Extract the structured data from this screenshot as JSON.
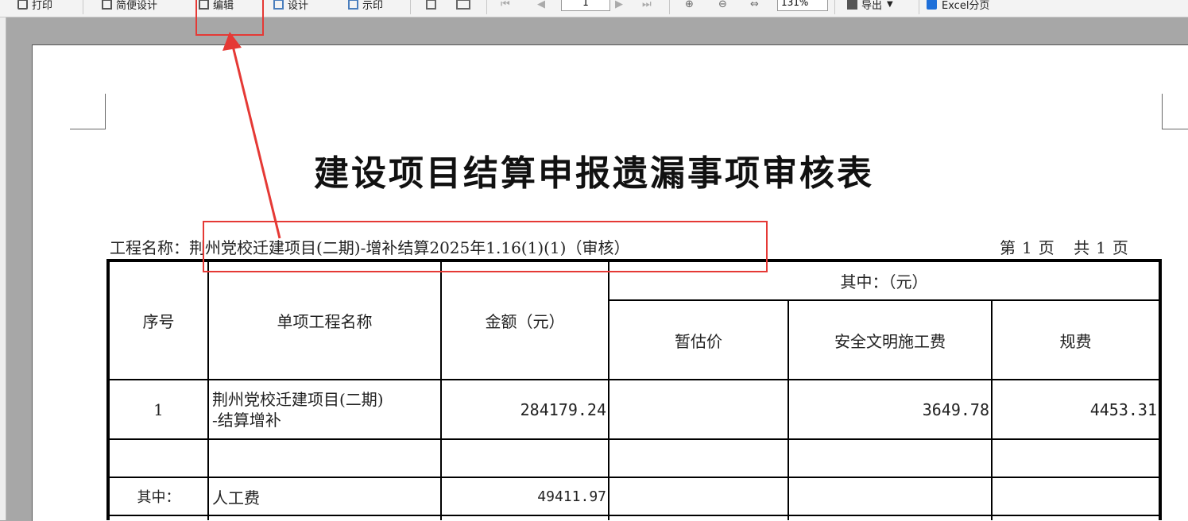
{
  "toolbar": {
    "print_label": "打印",
    "simple_design_label": "简便设计",
    "edit_label": "编辑",
    "design_label": "设计",
    "show_label": "示印",
    "page_value": "1",
    "zoom_value": "131%",
    "export_label": "导出",
    "excel_label": "Excel分页"
  },
  "report": {
    "title": "建设项目结算申报遗漏事项审核表",
    "project_label": "工程名称：",
    "project_name": "荆州党校迁建项目(二期)-增补结算2025年1.16(1)(1)（审核）",
    "page_prefix": "第",
    "page_current": "1",
    "page_mid": "页",
    "page_total_prefix": "共",
    "page_total": "1",
    "page_suffix": "页"
  },
  "table": {
    "headers": {
      "seq": "序号",
      "name": "单项工程名称",
      "amount": "金额（元）",
      "group": "其中：（元）",
      "provisional": "暂估价",
      "safety": "安全文明施工费",
      "fees": "规费"
    },
    "rows": [
      {
        "seq": "1",
        "name_line1": "荆州党校迁建项目(二期)",
        "name_line2": "-结算增补",
        "amount": "284179.24",
        "provisional": "",
        "safety": "3649.78",
        "fees": "4453.31"
      },
      {
        "seq": "",
        "name": "",
        "amount": "",
        "provisional": "",
        "safety": "",
        "fees": ""
      },
      {
        "seq": "其中：",
        "name": "人工费",
        "amount": "49411.97",
        "provisional": "",
        "safety": "",
        "fees": ""
      }
    ]
  },
  "annotation_color": "#e53935"
}
